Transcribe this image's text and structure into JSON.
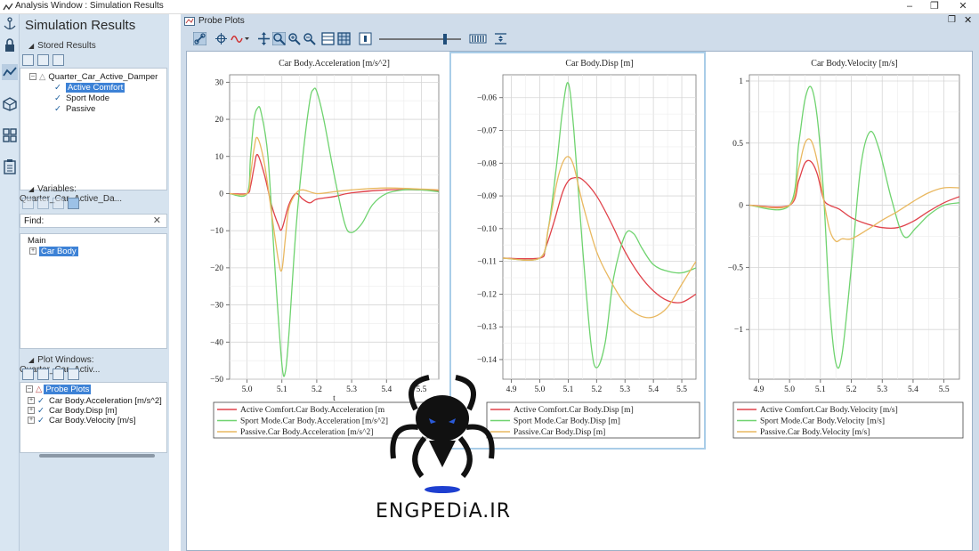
{
  "window": {
    "title": "Analysis Window : Simulation Results"
  },
  "browser": {
    "title": "Simulation Results",
    "stored_results": {
      "header": "Stored Results",
      "model": "Quarter_Car_Active_Damper",
      "results": [
        "Active Comfort",
        "Sport Mode",
        "Passive"
      ],
      "selected": "Active Comfort"
    },
    "variables": {
      "header": "Variables: Quarter_Car_Active_Da...",
      "find_label": "Find:",
      "find_value": "",
      "root": "Main",
      "item": "Car Body"
    },
    "plot_windows": {
      "header": "Plot Windows: Quarter_Car_Activ...",
      "root": "Probe Plots",
      "items": [
        "Car Body.Acceleration [m/s^2]",
        "Car Body.Disp [m]",
        "Car Body.Velocity [m/s]"
      ]
    }
  },
  "probe": {
    "title": "Probe Plots"
  },
  "colors": {
    "active": "#e0424a",
    "sport": "#6fd36f",
    "passive": "#e9b860",
    "selection": "#3d82d6"
  },
  "chart_data": [
    {
      "type": "line",
      "title": "Car Body.Acceleration [m/s^2]",
      "xlabel": "t",
      "ylabel": "",
      "xlim": [
        4.95,
        5.55
      ],
      "ylim": [
        -50,
        32
      ],
      "xticks": [
        5.0,
        5.1,
        5.2,
        5.3,
        5.4,
        5.5
      ],
      "xtick_labels": [
        "5.0",
        "5.1",
        "5.2",
        "5.3",
        "5.4",
        "5.5"
      ],
      "yticks": [
        30,
        20,
        10,
        0,
        -10,
        -20,
        -30,
        -40,
        -50
      ],
      "ytick_labels": [
        "30",
        "20",
        "10",
        "0",
        "−10",
        "−20",
        "−30",
        "−40",
        "−50"
      ],
      "grid": true,
      "legend_position": "bottom",
      "series": [
        {
          "name": "Active Comfort.Car Body.Acceleration [m",
          "color_key": "active",
          "x": [
            4.95,
            5.0,
            5.01,
            5.02,
            5.03,
            5.05,
            5.07,
            5.09,
            5.1,
            5.12,
            5.14,
            5.16,
            5.18,
            5.2,
            5.25,
            5.3,
            5.4,
            5.5,
            5.55
          ],
          "y": [
            0,
            0,
            2,
            7,
            10.5,
            5,
            -3,
            -8.5,
            -9.5,
            -3,
            0,
            -1.5,
            -2.5,
            -1.5,
            -0.8,
            0.2,
            1,
            1,
            0.8
          ]
        },
        {
          "name": "Sport Mode.Car Body.Acceleration [m/s^2]",
          "color_key": "sport",
          "x": [
            4.95,
            5.0,
            5.01,
            5.02,
            5.03,
            5.04,
            5.06,
            5.08,
            5.1,
            5.11,
            5.12,
            5.14,
            5.16,
            5.18,
            5.19,
            5.2,
            5.22,
            5.25,
            5.28,
            5.3,
            5.33,
            5.36,
            5.4,
            5.45,
            5.5,
            5.55
          ],
          "y": [
            0,
            0,
            10,
            20,
            23,
            22,
            10,
            -20,
            -46,
            -48,
            -38,
            -10,
            10,
            25,
            28,
            27.5,
            20,
            5,
            -8,
            -10.5,
            -8,
            -3,
            0,
            1,
            1,
            0.5
          ]
        },
        {
          "name": "Passive.Car Body.Acceleration [m/s^2]",
          "color_key": "passive",
          "x": [
            4.95,
            5.0,
            5.01,
            5.02,
            5.03,
            5.05,
            5.07,
            5.09,
            5.1,
            5.11,
            5.12,
            5.14,
            5.16,
            5.2,
            5.25,
            5.3,
            5.4,
            5.5,
            5.55
          ],
          "y": [
            0,
            0,
            5,
            12,
            15,
            8,
            -5,
            -18,
            -20.5,
            -12,
            -4,
            0,
            1,
            0,
            0.5,
            1,
            1.5,
            1.2,
            1
          ]
        }
      ]
    },
    {
      "type": "line",
      "title": "Car Body.Disp [m]",
      "xlabel": "",
      "ylabel": "",
      "xlim": [
        4.87,
        5.55
      ],
      "ylim": [
        -0.146,
        -0.053
      ],
      "xticks": [
        4.9,
        5.0,
        5.1,
        5.2,
        5.3,
        5.4,
        5.5
      ],
      "xtick_labels": [
        "4.9",
        "5.0",
        "5.1",
        "5.2",
        "5.3",
        "5.4",
        "5.5"
      ],
      "yticks": [
        -0.06,
        -0.07,
        -0.08,
        -0.09,
        -0.1,
        -0.11,
        -0.12,
        -0.13,
        -0.14
      ],
      "ytick_labels": [
        "−0.06",
        "−0.07",
        "−0.08",
        "−0.09",
        "−0.10",
        "−0.11",
        "−0.12",
        "−0.13",
        "−0.14"
      ],
      "grid": true,
      "legend_position": "bottom",
      "series": [
        {
          "name": "Active Comfort.Car Body.Disp [m]",
          "color_key": "active",
          "x": [
            4.87,
            5.0,
            5.02,
            5.05,
            5.08,
            5.1,
            5.12,
            5.15,
            5.2,
            5.25,
            5.3,
            5.35,
            5.4,
            5.45,
            5.5,
            5.55
          ],
          "y": [
            -0.109,
            -0.109,
            -0.106,
            -0.098,
            -0.089,
            -0.0855,
            -0.0845,
            -0.085,
            -0.09,
            -0.098,
            -0.107,
            -0.114,
            -0.119,
            -0.122,
            -0.1225,
            -0.12
          ]
        },
        {
          "name": "Sport Mode.Car Body.Disp [m]",
          "color_key": "sport",
          "x": [
            4.87,
            5.0,
            5.03,
            5.06,
            5.08,
            5.1,
            5.12,
            5.15,
            5.18,
            5.2,
            5.23,
            5.26,
            5.3,
            5.33,
            5.36,
            5.4,
            5.45,
            5.5,
            5.55
          ],
          "y": [
            -0.109,
            -0.109,
            -0.1,
            -0.08,
            -0.064,
            -0.0555,
            -0.07,
            -0.105,
            -0.135,
            -0.1425,
            -0.135,
            -0.115,
            -0.102,
            -0.1015,
            -0.106,
            -0.111,
            -0.113,
            -0.1135,
            -0.112
          ]
        },
        {
          "name": "Passive.Car Body.Disp [m]",
          "color_key": "passive",
          "x": [
            4.87,
            5.0,
            5.03,
            5.06,
            5.08,
            5.1,
            5.12,
            5.15,
            5.2,
            5.25,
            5.3,
            5.35,
            5.4,
            5.45,
            5.5,
            5.55
          ],
          "y": [
            -0.109,
            -0.109,
            -0.1,
            -0.086,
            -0.08,
            -0.078,
            -0.081,
            -0.092,
            -0.107,
            -0.116,
            -0.123,
            -0.1265,
            -0.127,
            -0.124,
            -0.117,
            -0.11
          ]
        }
      ]
    },
    {
      "type": "line",
      "title": "Car Body.Velocity [m/s]",
      "xlabel": "",
      "ylabel": "",
      "xlim": [
        4.87,
        5.55
      ],
      "ylim": [
        -1.4,
        1.05
      ],
      "xticks": [
        4.9,
        5.0,
        5.1,
        5.2,
        5.3,
        5.4,
        5.5
      ],
      "xtick_labels": [
        "4.9",
        "5.0",
        "5.1",
        "5.2",
        "5.3",
        "5.4",
        "5.5"
      ],
      "yticks": [
        1,
        0.5,
        0,
        -0.5,
        -1
      ],
      "ytick_labels": [
        "1",
        "0.5",
        "0",
        "−0.5",
        "−1"
      ],
      "grid": true,
      "legend_position": "bottom",
      "series": [
        {
          "name": "Active Comfort.Car Body.Velocity [m/s]",
          "color_key": "active",
          "x": [
            4.87,
            5.0,
            5.03,
            5.05,
            5.07,
            5.09,
            5.11,
            5.13,
            5.16,
            5.2,
            5.25,
            5.3,
            5.35,
            5.4,
            5.45,
            5.5,
            5.55
          ],
          "y": [
            0,
            0,
            0.2,
            0.34,
            0.35,
            0.25,
            0.05,
            0,
            -0.03,
            -0.1,
            -0.15,
            -0.18,
            -0.18,
            -0.13,
            -0.05,
            0.02,
            0.07
          ]
        },
        {
          "name": "Sport Mode.Car Body.Velocity [m/s]",
          "color_key": "sport",
          "x": [
            4.87,
            5.0,
            5.03,
            5.05,
            5.07,
            5.09,
            5.11,
            5.13,
            5.15,
            5.17,
            5.2,
            5.23,
            5.26,
            5.29,
            5.33,
            5.37,
            5.41,
            5.45,
            5.5,
            5.55
          ],
          "y": [
            0,
            0,
            0.5,
            0.85,
            0.95,
            0.7,
            0.1,
            -0.8,
            -1.27,
            -1.2,
            -0.5,
            0.3,
            0.59,
            0.45,
            0.05,
            -0.25,
            -0.18,
            -0.08,
            0,
            0.02
          ]
        },
        {
          "name": "Passive.Car Body.Velocity [m/s]",
          "color_key": "passive",
          "x": [
            4.87,
            5.0,
            5.03,
            5.05,
            5.07,
            5.09,
            5.11,
            5.13,
            5.15,
            5.17,
            5.2,
            5.25,
            5.3,
            5.35,
            5.4,
            5.45,
            5.5,
            5.55
          ],
          "y": [
            0,
            0,
            0.3,
            0.5,
            0.52,
            0.35,
            0.05,
            -0.2,
            -0.29,
            -0.27,
            -0.27,
            -0.2,
            -0.12,
            -0.05,
            0.03,
            0.1,
            0.14,
            0.14
          ]
        }
      ]
    }
  ]
}
